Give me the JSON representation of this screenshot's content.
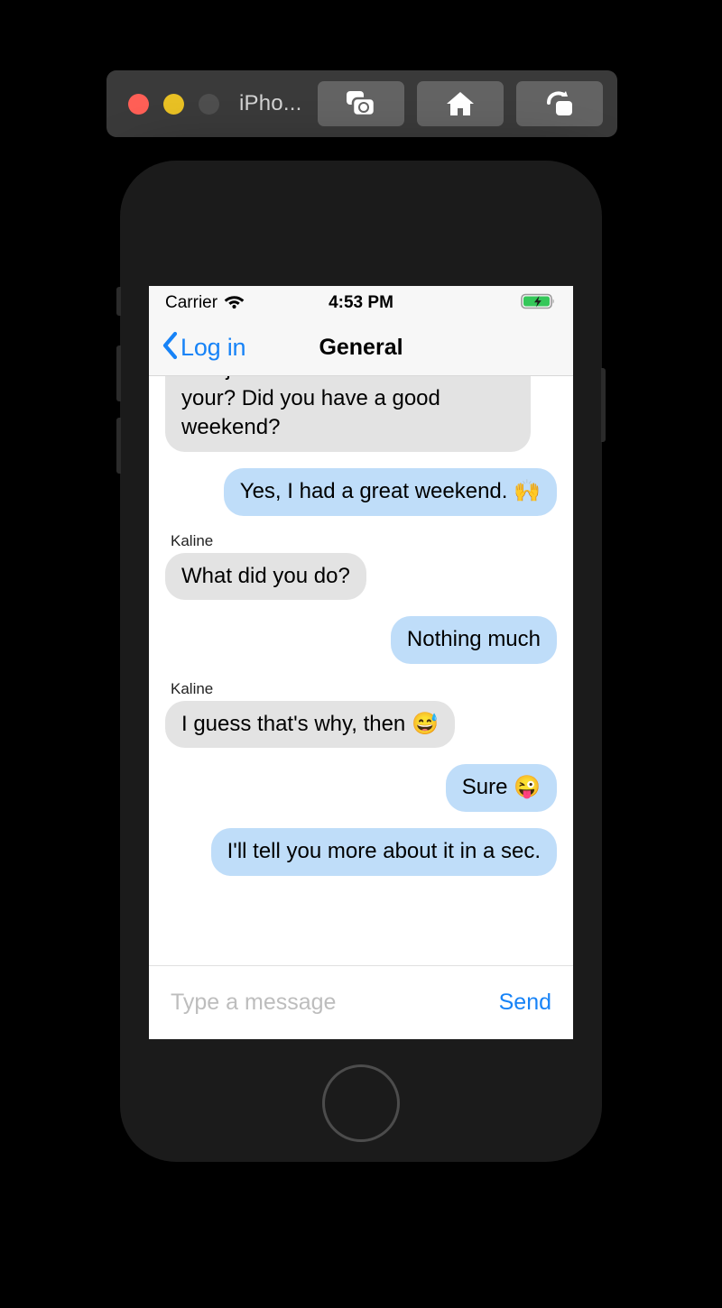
{
  "window": {
    "title": "iPho...",
    "traffic_lights": [
      {
        "name": "close",
        "color": "#ff5f56"
      },
      {
        "name": "minimize",
        "color": "#e8c024"
      },
      {
        "name": "zoom",
        "color": "#4e4e4e"
      }
    ],
    "toolbar_buttons": [
      {
        "name": "screenshot-button",
        "icon": "camera-icon"
      },
      {
        "name": "home-button",
        "icon": "home-icon"
      },
      {
        "name": "rotate-button",
        "icon": "rotate-icon"
      }
    ]
  },
  "statusbar": {
    "carrier": "Carrier",
    "wifi_icon": "wifi-icon",
    "time": "4:53 PM",
    "battery_icon": "battery-charging-icon"
  },
  "navbar": {
    "back_label": "Log in",
    "back_icon": "chevron-left-icon",
    "title": "General"
  },
  "conversation": {
    "messages": [
      {
        "side": "them",
        "sender": null,
        "text": "was just for them. How about your? Did you have a good weekend?",
        "clipped": true
      },
      {
        "side": "me",
        "sender": null,
        "text": "Yes, I had a great weekend. 🙌",
        "clipped": false
      },
      {
        "side": "them",
        "sender": "Kaline",
        "text": "What did you do?",
        "clipped": false
      },
      {
        "side": "me",
        "sender": null,
        "text": "Nothing much",
        "clipped": false
      },
      {
        "side": "them",
        "sender": "Kaline",
        "text": "I guess that's why, then 😅",
        "clipped": false
      },
      {
        "side": "me",
        "sender": null,
        "text": "Sure 😜",
        "clipped": false
      },
      {
        "side": "me",
        "sender": null,
        "text": "I'll tell you more about it in a sec.",
        "clipped": false
      }
    ]
  },
  "composer": {
    "input_value": "",
    "input_placeholder": "Type a message",
    "send_label": "Send"
  },
  "colors": {
    "accent_blue": "#1783f7",
    "bubble_me": "#bfddf9",
    "bubble_them": "#e3e3e3",
    "titlebar": "#3a3a3a",
    "phone_body": "#1b1b1b"
  }
}
